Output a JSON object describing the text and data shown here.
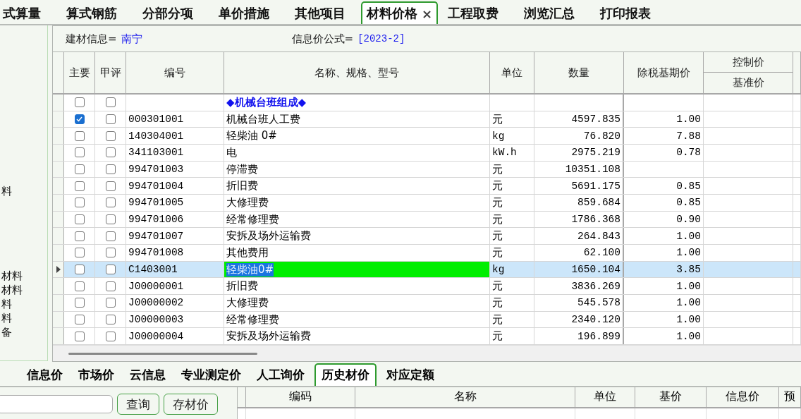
{
  "top_tabs": [
    {
      "label": "式算量",
      "selected": false
    },
    {
      "label": "算式钢筋",
      "selected": false
    },
    {
      "label": "分部分项",
      "selected": false
    },
    {
      "label": "单价措施",
      "selected": false
    },
    {
      "label": "其他项目",
      "selected": false
    },
    {
      "label": "材料价格",
      "selected": true,
      "close": "×"
    },
    {
      "label": "工程取费",
      "selected": false
    },
    {
      "label": "浏览汇总",
      "selected": false
    },
    {
      "label": "打印报表",
      "selected": false
    }
  ],
  "sidebar": {
    "items": [
      "料",
      "材料",
      "材料",
      "料",
      "料",
      "备"
    ]
  },
  "info_bar": {
    "material_info_label": "建材信息=",
    "material_info_value": "南宁",
    "formula_label": "信息价公式=",
    "formula_value": "[2023-2]"
  },
  "table": {
    "columns": [
      "主要",
      "甲评",
      "编号",
      "名称、规格、型号",
      "单位",
      "数量",
      "除税基期价"
    ],
    "price_columns": [
      "控制价",
      "基准价"
    ],
    "rows": [
      {
        "kind": "group",
        "main": false,
        "evaluated": false,
        "code": "",
        "name": "◆机械台班组成◆",
        "unit": "",
        "quantity": "",
        "price": "",
        "selected": false
      },
      {
        "kind": "item",
        "main": true,
        "evaluated": false,
        "code": "000301001",
        "name": "机械台班人工费",
        "unit": "元",
        "quantity": "4597.835",
        "price": "1.00",
        "selected": false
      },
      {
        "kind": "item",
        "main": false,
        "evaluated": false,
        "code": "140304001",
        "name": "轻柴油 0#",
        "unit": "kg",
        "quantity": "76.820",
        "price": "7.88",
        "selected": false
      },
      {
        "kind": "item",
        "main": false,
        "evaluated": false,
        "code": "341103001",
        "name": "电",
        "unit": "kW.h",
        "quantity": "2975.219",
        "price": "0.78",
        "selected": false
      },
      {
        "kind": "item",
        "main": false,
        "evaluated": false,
        "code": "994701003",
        "name": "停滞费",
        "unit": "元",
        "quantity": "10351.108",
        "price": "",
        "selected": false
      },
      {
        "kind": "item",
        "main": false,
        "evaluated": false,
        "code": "994701004",
        "name": "折旧费",
        "unit": "元",
        "quantity": "5691.175",
        "price": "0.85",
        "selected": false
      },
      {
        "kind": "item",
        "main": false,
        "evaluated": false,
        "code": "994701005",
        "name": "大修理费",
        "unit": "元",
        "quantity": "859.684",
        "price": "0.85",
        "selected": false
      },
      {
        "kind": "item",
        "main": false,
        "evaluated": false,
        "code": "994701006",
        "name": "经常修理费",
        "unit": "元",
        "quantity": "1786.368",
        "price": "0.90",
        "selected": false
      },
      {
        "kind": "item",
        "main": false,
        "evaluated": false,
        "code": "994701007",
        "name": "安拆及场外运输费",
        "unit": "元",
        "quantity": "264.843",
        "price": "1.00",
        "selected": false
      },
      {
        "kind": "item",
        "main": false,
        "evaluated": false,
        "code": "994701008",
        "name": "其他费用",
        "unit": "元",
        "quantity": "62.100",
        "price": "1.00",
        "selected": false
      },
      {
        "kind": "item",
        "main": false,
        "evaluated": false,
        "code": "C1403001",
        "name": "轻柴油0#",
        "unit": "kg",
        "quantity": "1650.104",
        "price": "3.85",
        "selected": true
      },
      {
        "kind": "item",
        "main": false,
        "evaluated": false,
        "code": "J00000001",
        "name": "折旧费",
        "unit": "元",
        "quantity": "3836.269",
        "price": "1.00",
        "selected": false
      },
      {
        "kind": "item",
        "main": false,
        "evaluated": false,
        "code": "J00000002",
        "name": "大修理费",
        "unit": "元",
        "quantity": "545.578",
        "price": "1.00",
        "selected": false
      },
      {
        "kind": "item",
        "main": false,
        "evaluated": false,
        "code": "J00000003",
        "name": "经常修理费",
        "unit": "元",
        "quantity": "2340.120",
        "price": "1.00",
        "selected": false
      },
      {
        "kind": "item",
        "main": false,
        "evaluated": false,
        "code": "J00000004",
        "name": "安拆及场外运输费",
        "unit": "元",
        "quantity": "196.899",
        "price": "1.00",
        "selected": false
      }
    ]
  },
  "bottom_tabs": [
    {
      "label": "信息价",
      "selected": false
    },
    {
      "label": "市场价",
      "selected": false
    },
    {
      "label": "云信息",
      "selected": false
    },
    {
      "label": "专业测定价",
      "selected": false
    },
    {
      "label": "人工询价",
      "selected": false
    },
    {
      "label": "历史材价",
      "selected": true
    },
    {
      "label": "对应定额",
      "selected": false
    }
  ],
  "search": {
    "buttons": [
      "查询",
      "存材价"
    ]
  },
  "history_table": {
    "columns": [
      "编码",
      "名称",
      "单位",
      "基价",
      "信息价",
      "预"
    ]
  }
}
